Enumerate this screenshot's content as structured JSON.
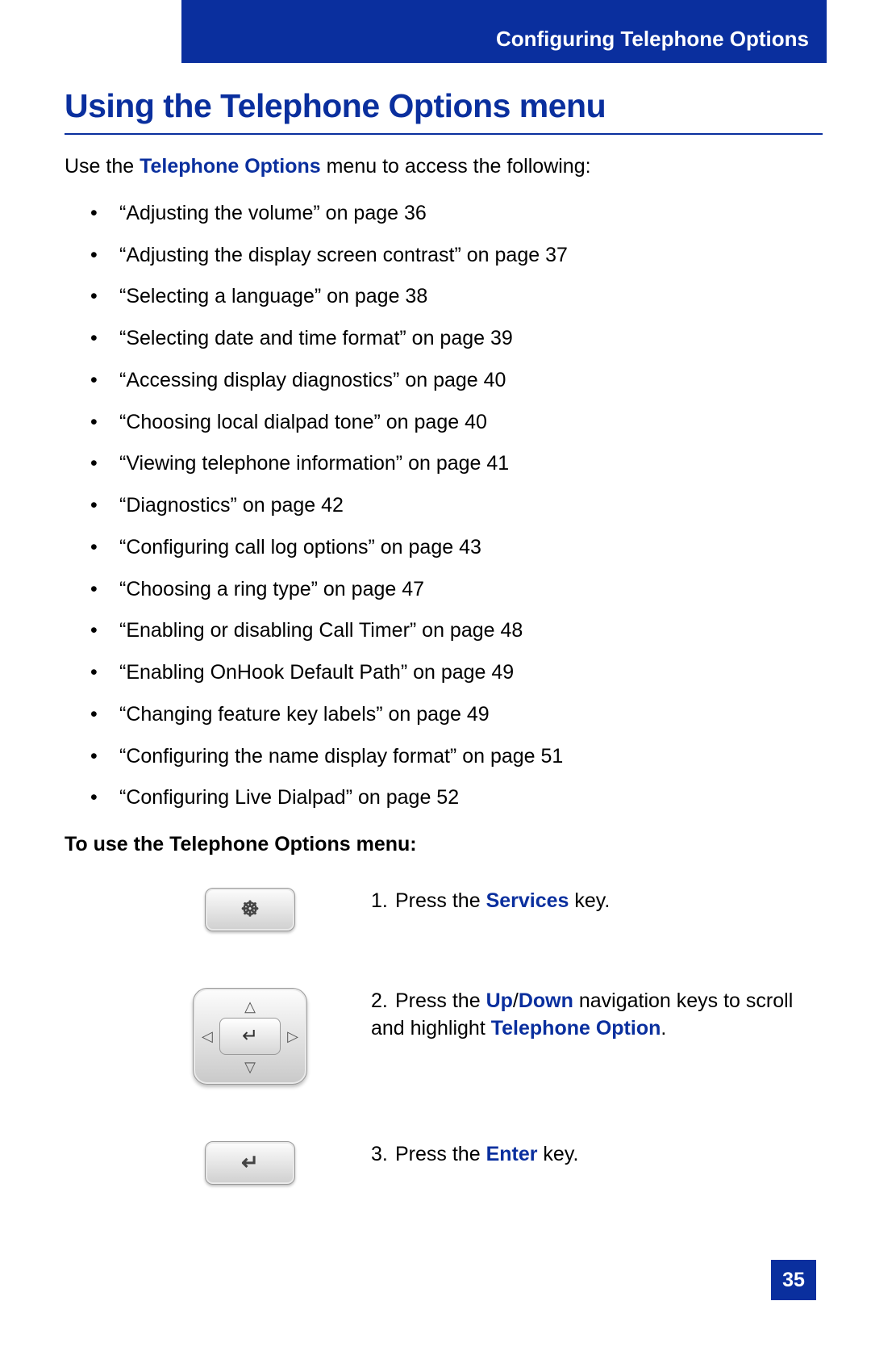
{
  "header": {
    "section": "Configuring Telephone Options"
  },
  "title": "Using the Telephone Options menu",
  "intro": {
    "prefix": "Use the ",
    "em": "Telephone Options",
    "suffix": " menu to access the following:"
  },
  "bullets": [
    "“Adjusting the volume” on page 36",
    "“Adjusting the display screen contrast” on page 37",
    "“Selecting a language” on page 38",
    "“Selecting date and time format” on page 39",
    "“Accessing display diagnostics” on page 40",
    "“Choosing local dialpad tone” on page 40",
    "“Viewing telephone information” on page 41",
    "“Diagnostics” on page 42",
    "“Configuring call log options” on page 43",
    "“Choosing a ring type” on page 47",
    "“Enabling or disabling Call Timer” on page 48",
    "“Enabling OnHook Default Path” on page 49",
    "“Changing feature key labels” on page 49",
    "“Configuring the name display format” on page 51",
    "“Configuring Live Dialpad” on page 52"
  ],
  "subtitle": "To use the Telephone Options menu:",
  "steps": [
    {
      "num": "1.",
      "parts": [
        {
          "t": "Press the "
        },
        {
          "t": "Services",
          "em": true
        },
        {
          "t": " key."
        }
      ],
      "icon": "services"
    },
    {
      "num": "2.",
      "parts": [
        {
          "t": "Press the "
        },
        {
          "t": "Up",
          "em": true
        },
        {
          "t": "/"
        },
        {
          "t": "Down",
          "em": true
        },
        {
          "t": " navigation keys to scroll and highlight "
        },
        {
          "t": "Telephone Option",
          "em": true
        },
        {
          "t": "."
        }
      ],
      "icon": "navpad"
    },
    {
      "num": "3.",
      "parts": [
        {
          "t": "Press the "
        },
        {
          "t": "Enter",
          "em": true
        },
        {
          "t": " key."
        }
      ],
      "icon": "enter"
    }
  ],
  "page_number": "35",
  "icon_glyphs": {
    "services": "☸",
    "enter": "↵"
  }
}
